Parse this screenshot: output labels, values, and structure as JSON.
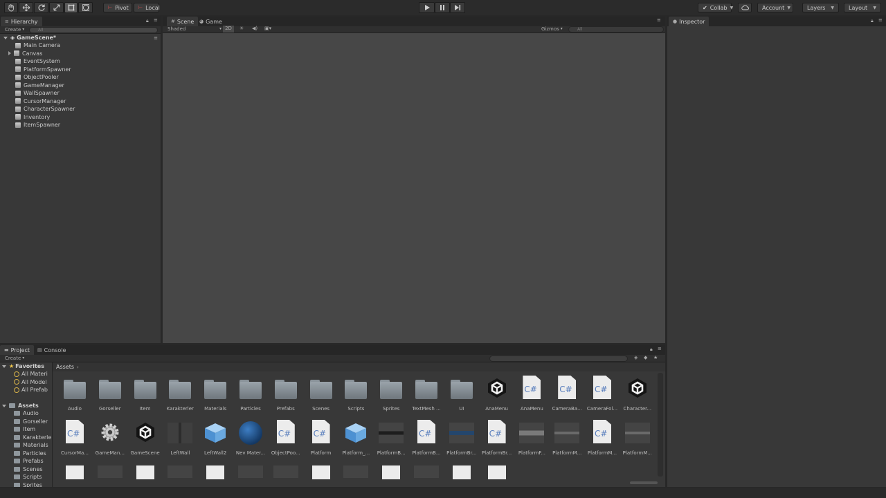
{
  "toolbar": {
    "pivot_label": "Pivot",
    "local_label": "Local",
    "collab_label": "Collab",
    "account_label": "Account",
    "layers_label": "Layers",
    "layout_label": "Layout"
  },
  "hierarchy": {
    "tab_label": "Hierarchy",
    "create_label": "Create",
    "search_placeholder": "All",
    "scene_name": "GameScene*",
    "items": [
      {
        "label": "Main Camera",
        "expandable": false
      },
      {
        "label": "Canvas",
        "expandable": true
      },
      {
        "label": "EventSystem",
        "expandable": false
      },
      {
        "label": "PlatformSpawner",
        "expandable": false
      },
      {
        "label": "ObjectPooler",
        "expandable": false
      },
      {
        "label": "GameManager",
        "expandable": false
      },
      {
        "label": "WallSpawner",
        "expandable": false
      },
      {
        "label": "CursorManager",
        "expandable": false
      },
      {
        "label": "CharacterSpawner",
        "expandable": false
      },
      {
        "label": "Inventory",
        "expandable": false
      },
      {
        "label": "ItemSpawner",
        "expandable": false
      }
    ]
  },
  "scene": {
    "scene_tab": "Scene",
    "game_tab": "Game",
    "shading_mode": "Shaded",
    "toggle_2d": "2D",
    "gizmos_label": "Gizmos",
    "search_placeholder": "All",
    "background_color": "#474747"
  },
  "inspector": {
    "tab_label": "Inspector"
  },
  "project": {
    "project_tab": "Project",
    "console_tab": "Console",
    "create_label": "Create",
    "breadcrumb": "Assets",
    "favorites_label": "Favorites",
    "favorites": [
      "All Materi",
      "All Model",
      "All Prefab"
    ],
    "assets_label": "Assets",
    "tree": [
      "Audio",
      "Gorseller",
      "Item",
      "Karakterler",
      "Materials",
      "Particles",
      "Prefabs",
      "Scenes",
      "Scripts",
      "Sprites"
    ],
    "rows": [
      [
        {
          "label": "Audio",
          "type": "folder"
        },
        {
          "label": "Gorseller",
          "type": "folder"
        },
        {
          "label": "Item",
          "type": "folder"
        },
        {
          "label": "Karakterler",
          "type": "folder"
        },
        {
          "label": "Materials",
          "type": "folder"
        },
        {
          "label": "Particles",
          "type": "folder"
        },
        {
          "label": "Prefabs",
          "type": "folder"
        },
        {
          "label": "Scenes",
          "type": "folder"
        },
        {
          "label": "Scripts",
          "type": "folder"
        },
        {
          "label": "Sprites",
          "type": "folder"
        },
        {
          "label": "TextMesh ...",
          "type": "folder"
        },
        {
          "label": "UI",
          "type": "folder"
        },
        {
          "label": "AnaMenu",
          "type": "unity"
        },
        {
          "label": "AnaMenu",
          "type": "csharp"
        },
        {
          "label": "CameraBa...",
          "type": "csharp"
        },
        {
          "label": "CameraFol...",
          "type": "csharp"
        },
        {
          "label": "Character...",
          "type": "unity"
        }
      ],
      [
        {
          "label": "CursorMa...",
          "type": "csharp"
        },
        {
          "label": "GameMan...",
          "type": "gear"
        },
        {
          "label": "GameScene",
          "type": "unity"
        },
        {
          "label": "LeftWall",
          "type": "wall"
        },
        {
          "label": "LeftWall2",
          "type": "cube"
        },
        {
          "label": "Nev Mater...",
          "type": "sphere"
        },
        {
          "label": "ObjectPoo...",
          "type": "csharp"
        },
        {
          "label": "Platform",
          "type": "csharp"
        },
        {
          "label": "Platform_...",
          "type": "cube"
        },
        {
          "label": "PlatformB...",
          "type": "bar-dark"
        },
        {
          "label": "PlatformB...",
          "type": "csharp"
        },
        {
          "label": "PlatformBr...",
          "type": "bar-blue"
        },
        {
          "label": "PlatformBr...",
          "type": "csharp"
        },
        {
          "label": "PlatformF...",
          "type": "bar-light"
        },
        {
          "label": "PlatformM...",
          "type": "bar-grey"
        },
        {
          "label": "PlatformM...",
          "type": "csharp"
        },
        {
          "label": "PlatformM...",
          "type": "bar-grey"
        }
      ],
      [
        {
          "label": "",
          "type": "page"
        },
        {
          "label": "",
          "type": "dark"
        },
        {
          "label": "",
          "type": "page"
        },
        {
          "label": "",
          "type": "dark"
        },
        {
          "label": "",
          "type": "page"
        },
        {
          "label": "",
          "type": "dark"
        },
        {
          "label": "",
          "type": "dark"
        },
        {
          "label": "",
          "type": "page"
        },
        {
          "label": "",
          "type": "dark"
        },
        {
          "label": "",
          "type": "page"
        },
        {
          "label": "",
          "type": "dark"
        },
        {
          "label": "",
          "type": "page"
        },
        {
          "label": "",
          "type": "page"
        }
      ]
    ]
  }
}
